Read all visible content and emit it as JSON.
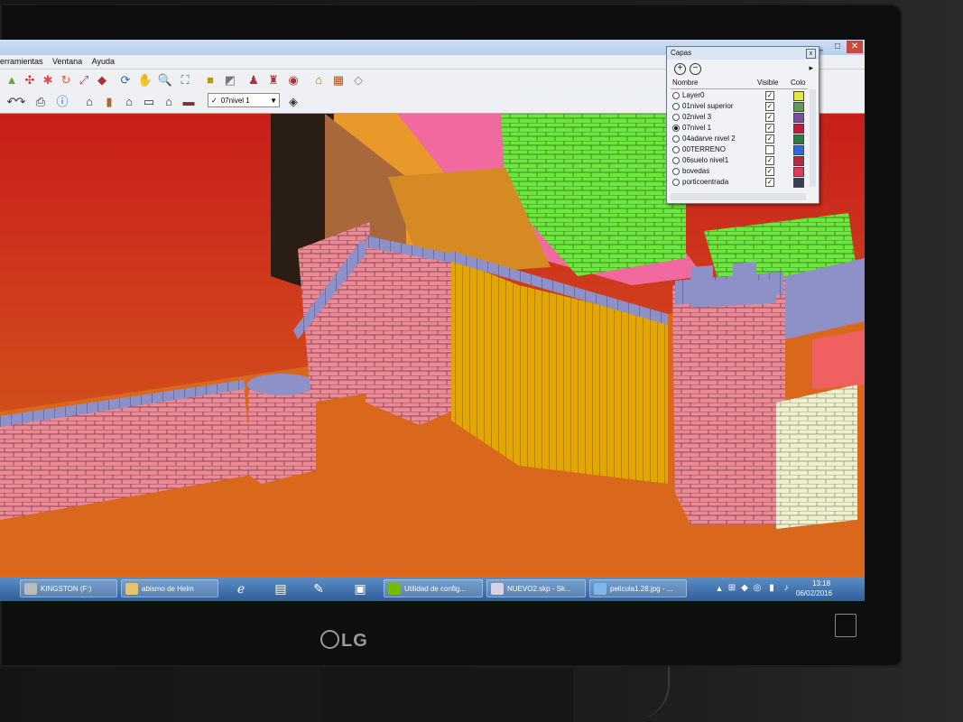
{
  "app": {
    "menu": [
      "erramientas",
      "Ventana",
      "Ayuda"
    ],
    "active_layer": "07nivel 1"
  },
  "colors": {
    "sky_red": "#c81e1b",
    "ground_orange": "#d9681d",
    "wall_pink": "#e98a96",
    "crenel_blue": "#8e90c8",
    "tower_yellow": "#e3a600",
    "roof_pink": "#f06aa0",
    "keep_green": "#6ce83a",
    "cream": "#eef0cf"
  },
  "capas": {
    "title": "Capas",
    "col_name": "Nombre",
    "col_visible": "Visible",
    "col_color": "Colo",
    "layers": [
      {
        "name": "Layer0",
        "active": false,
        "visible": true,
        "color": "#e4ea3a"
      },
      {
        "name": "01nivel superior",
        "active": false,
        "visible": true,
        "color": "#5f9c5a"
      },
      {
        "name": "02nivel 3",
        "active": false,
        "visible": true,
        "color": "#7a4fa0"
      },
      {
        "name": "07nivel 1",
        "active": true,
        "visible": true,
        "color": "#c21b3a"
      },
      {
        "name": "04adarve nivel 2",
        "active": false,
        "visible": true,
        "color": "#2e7b3b"
      },
      {
        "name": "00TERRENO",
        "active": false,
        "visible": false,
        "color": "#2a6bd8"
      },
      {
        "name": "06suelo nivel1",
        "active": false,
        "visible": true,
        "color": "#b52a3a"
      },
      {
        "name": "bovedas",
        "active": false,
        "visible": true,
        "color": "#e03a5a"
      },
      {
        "name": "porticoentrada",
        "active": false,
        "visible": true,
        "color": "#3a3a5a"
      }
    ]
  },
  "taskbar": {
    "items": [
      {
        "label": "KINGSTON (F:)",
        "icon": "drive-icon"
      },
      {
        "label": "abismo de Helm",
        "icon": "folder-icon"
      },
      {
        "label": "Utilidad de config...",
        "icon": "nvidia-icon"
      },
      {
        "label": "NUEVO2.skp - Sk...",
        "icon": "sketchup-icon"
      },
      {
        "label": "pelicula1.28.jpg - ...",
        "icon": "image-icon"
      }
    ],
    "time": "13:18",
    "date": "06/02/2016"
  },
  "monitor": {
    "brand": "LG"
  }
}
